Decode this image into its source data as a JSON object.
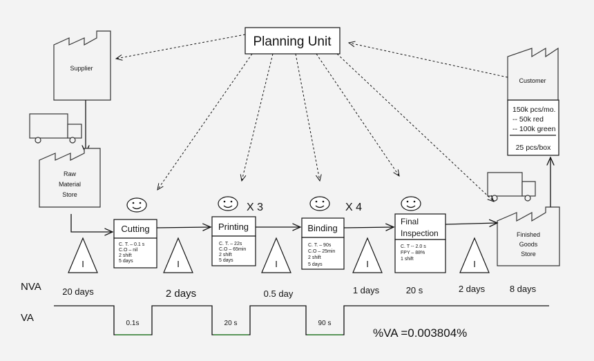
{
  "planning_unit": "Planning Unit",
  "supplier": "Supplier",
  "raw_store": [
    "Raw",
    "Material",
    "Store"
  ],
  "customer": {
    "label": "Customer",
    "demand": [
      "150k pcs/mo.",
      "--  50k red",
      "-- 100k green"
    ],
    "packaging": "25 pcs/box"
  },
  "finished_store": [
    "Finished",
    "Goods",
    "Store"
  ],
  "inventory_symbol": "I",
  "processes": [
    {
      "name": "Cutting",
      "data": [
        "C. T. – 0.1 s",
        "C.O – nil",
        "2 shift",
        "5 days"
      ],
      "multiplier": ""
    },
    {
      "name": "Printing",
      "data": [
        "C. T. – 22s",
        "C.O – 65min",
        "2 shift",
        "5 days"
      ],
      "multiplier": "X 3"
    },
    {
      "name": "Binding",
      "data": [
        "C. T. – 90s",
        "C.O – 25min",
        "2 shift",
        "5 days"
      ],
      "multiplier": "X 4"
    },
    {
      "name": [
        "Final",
        "Inspection"
      ],
      "data": [
        "C. T -- 2.0 s",
        "FPY – 88%",
        "1 shift"
      ],
      "multiplier": ""
    }
  ],
  "timeline": {
    "nva_label": "NVA",
    "va_label": "VA",
    "nva": [
      "20 days",
      "2 days",
      "0.5 day",
      "1 days",
      "20 s",
      "2 days",
      "8 days"
    ],
    "va": [
      "0.1s",
      "20 s",
      "90 s"
    ],
    "va_percent": "%VA =0.003804%"
  }
}
